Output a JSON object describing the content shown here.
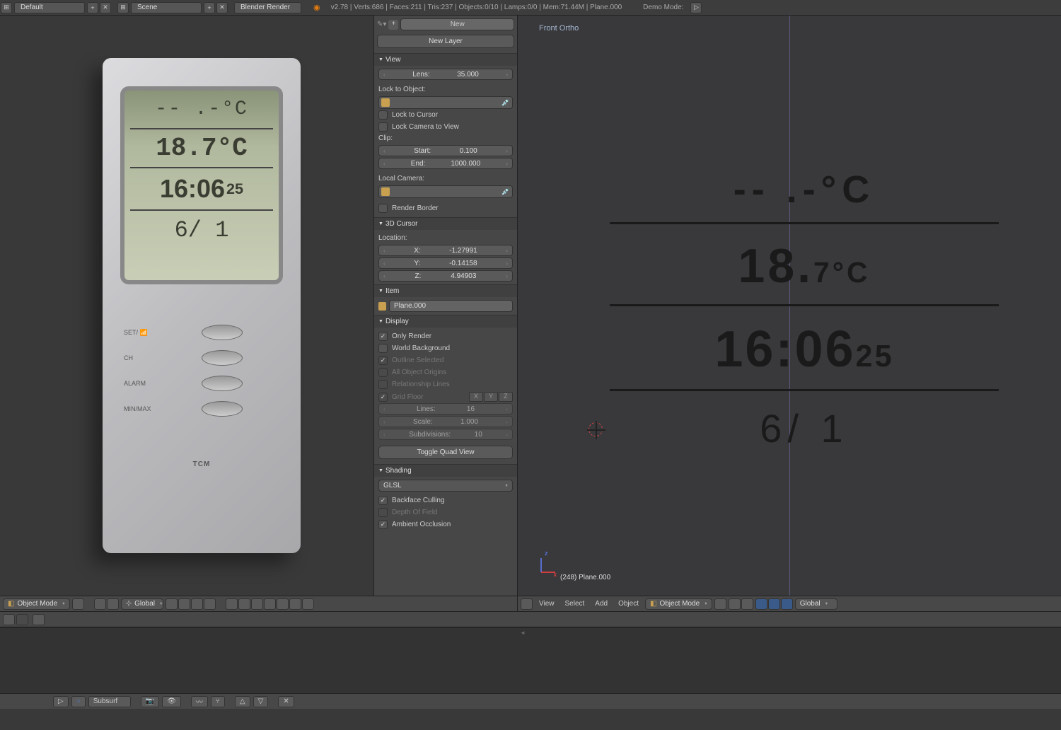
{
  "header": {
    "screen_layout": "Default",
    "scene": "Scene",
    "engine": "Blender Render",
    "stats": "v2.78 | Verts:686 | Faces:211 | Tris:237 | Objects:0/10 | Lamps:0/0 | Mem:71.44M | Plane.000",
    "demo_mode_label": "Demo Mode:"
  },
  "thermo": {
    "row1": "-- .-°C",
    "row2": "18.7°C",
    "row3_main": "16:06",
    "row3_sec": "25",
    "row4": "6/ 1",
    "btn1": "SET/ 📶",
    "btn2": "CH",
    "btn3": "ALARM",
    "btn4": "MIN/MAX",
    "logo": "TCM"
  },
  "panel": {
    "new_btn": "New",
    "new_layer_btn": "New Layer",
    "view": {
      "header": "View",
      "lens_label": "Lens:",
      "lens_value": "35.000",
      "lock_to_object": "Lock to Object:",
      "lock_to_cursor": "Lock to Cursor",
      "lock_camera": "Lock Camera to View",
      "clip": "Clip:",
      "start_label": "Start:",
      "start_value": "0.100",
      "end_label": "End:",
      "end_value": "1000.000",
      "local_camera": "Local Camera:",
      "render_border": "Render Border"
    },
    "cursor": {
      "header": "3D Cursor",
      "location": "Location:",
      "x_label": "X:",
      "x_value": "-1.27991",
      "y_label": "Y:",
      "y_value": "-0.14158",
      "z_label": "Z:",
      "z_value": "4.94903"
    },
    "item": {
      "header": "Item",
      "name": "Plane.000"
    },
    "display": {
      "header": "Display",
      "only_render": "Only Render",
      "world_bg": "World Background",
      "outline_sel": "Outline Selected",
      "all_origins": "All Object Origins",
      "rel_lines": "Relationship Lines",
      "grid_floor": "Grid Floor",
      "x": "X",
      "y": "Y",
      "z": "Z",
      "lines_label": "Lines:",
      "lines_value": "16",
      "scale_label": "Scale:",
      "scale_value": "1.000",
      "subdiv_label": "Subdivisions:",
      "subdiv_value": "10",
      "toggle_quad": "Toggle Quad View"
    },
    "shading": {
      "header": "Shading",
      "glsl": "GLSL",
      "backface": "Backface Culling",
      "dof": "Depth Of Field",
      "ao": "Ambient Occlusion"
    }
  },
  "viewport_right": {
    "view_label": "Front Ortho",
    "row1": "-- .-°C",
    "row2_main": "18.",
    "row2_sec": "7°C",
    "row3_main": "16:06",
    "row3_sec": "25",
    "row4": "6/ 1",
    "obj_label": "(248) Plane.000"
  },
  "toolbar": {
    "mode": "Object Mode",
    "orientation": "Global",
    "view": "View",
    "select": "Select",
    "add": "Add",
    "object": "Object"
  },
  "bottom": {
    "subsurf": "Subsurf"
  }
}
